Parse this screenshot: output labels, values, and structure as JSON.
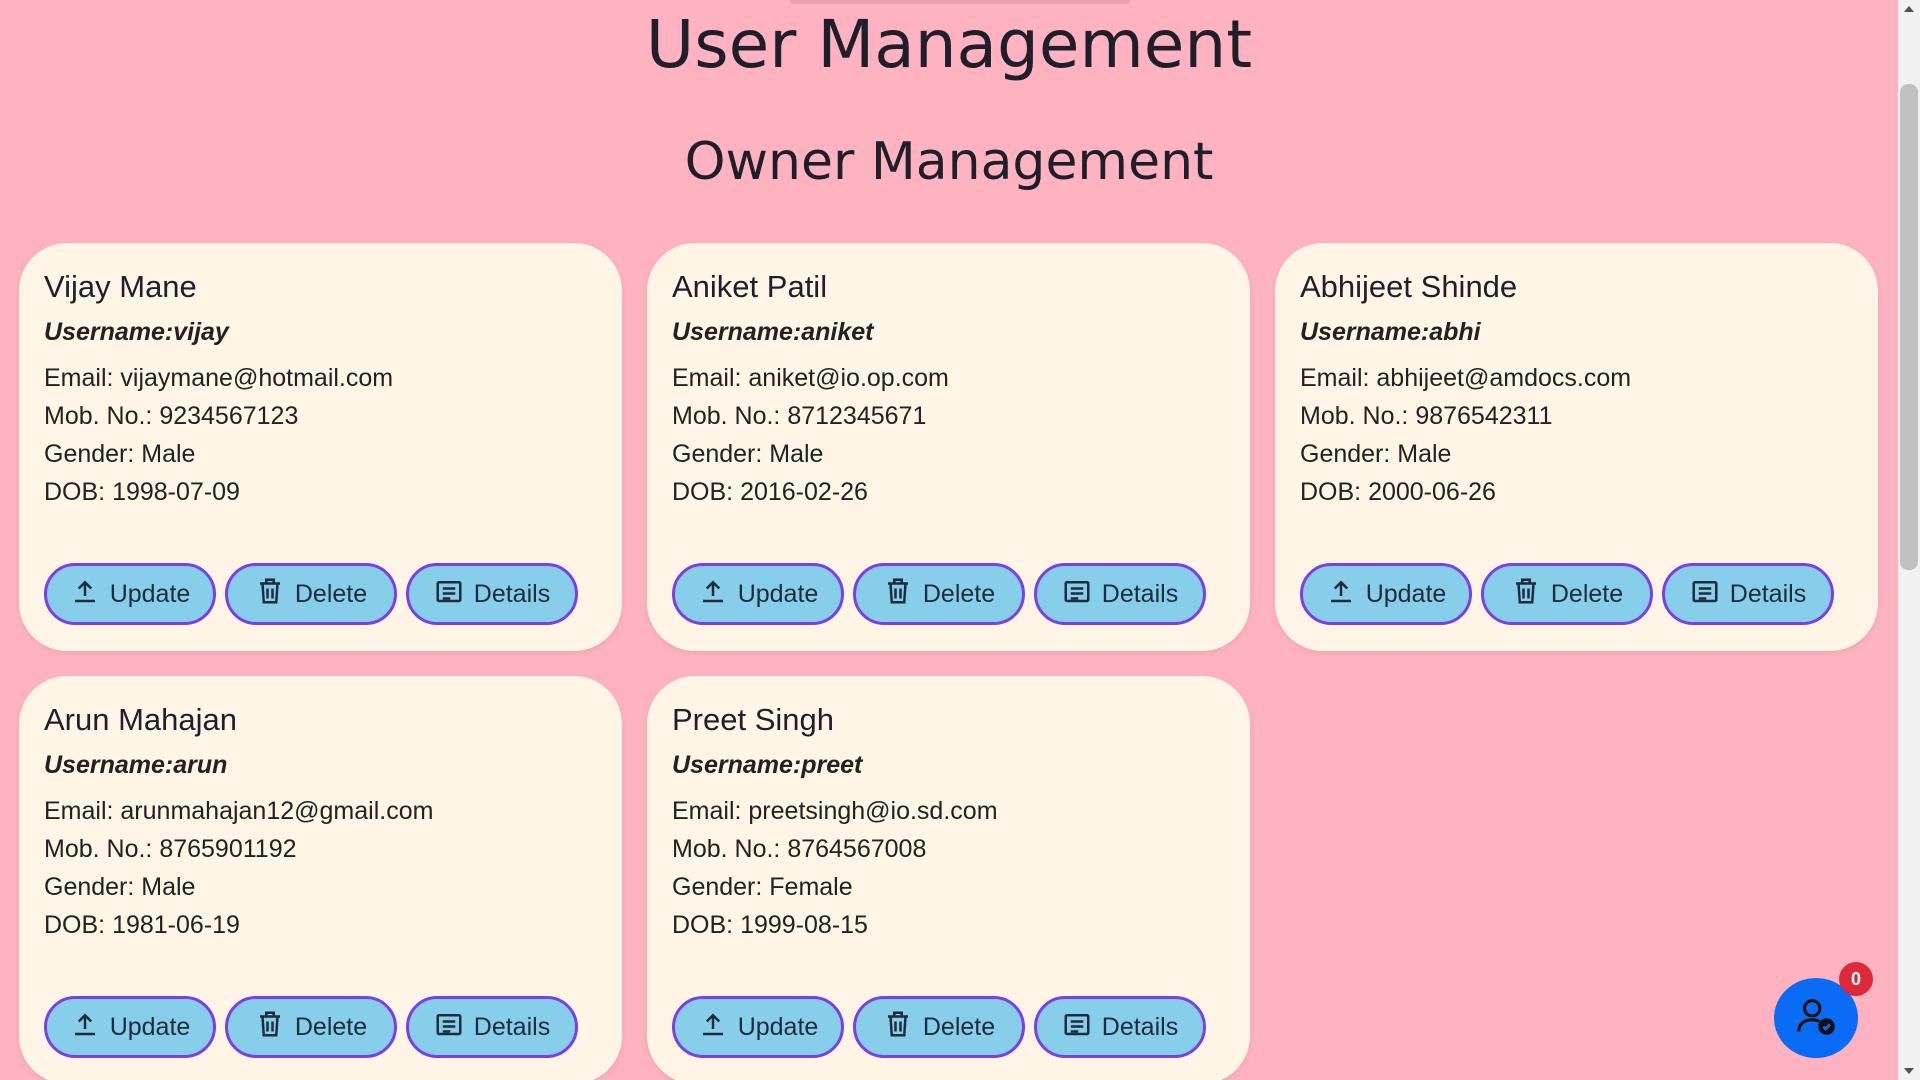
{
  "header": {
    "title": "User Management",
    "section_title": "Owner Management"
  },
  "buttons": {
    "update_label": "Update",
    "delete_label": "Delete",
    "details_label": "Details"
  },
  "owners": [
    {
      "name": "Vijay Mane",
      "username": "Username:vijay",
      "email": "Email: vijaymane@hotmail.com",
      "mobile": "Mob. No.: 9234567123",
      "gender": "Gender: Male",
      "dob": "DOB: 1998-07-09"
    },
    {
      "name": "Aniket Patil",
      "username": "Username:aniket",
      "email": "Email: aniket@io.op.com",
      "mobile": "Mob. No.: 8712345671",
      "gender": "Gender: Male",
      "dob": "DOB: 2016-02-26"
    },
    {
      "name": "Abhijeet Shinde",
      "username": "Username:abhi",
      "email": "Email: abhijeet@amdocs.com",
      "mobile": "Mob. No.: 9876542311",
      "gender": "Gender: Male",
      "dob": "DOB: 2000-06-26"
    },
    {
      "name": "Arun Mahajan",
      "username": "Username:arun",
      "email": "Email: arunmahajan12@gmail.com",
      "mobile": "Mob. No.: 8765901192",
      "gender": "Gender: Male",
      "dob": "DOB: 1981-06-19"
    },
    {
      "name": "Preet Singh",
      "username": "Username:preet",
      "email": "Email: preetsingh@io.sd.com",
      "mobile": "Mob. No.: 8764567008",
      "gender": "Gender: Female",
      "dob": "DOB: 1999-08-15"
    }
  ],
  "fab": {
    "icon": "user-check-icon",
    "badge_count": "0"
  },
  "colors": {
    "background": "#ffb3c0",
    "card": "#fff5e6",
    "button_fill": "#87ceeb",
    "button_border": "#7b3fe4",
    "fab": "#0a6cf5",
    "badge": "#dc2a3a"
  }
}
